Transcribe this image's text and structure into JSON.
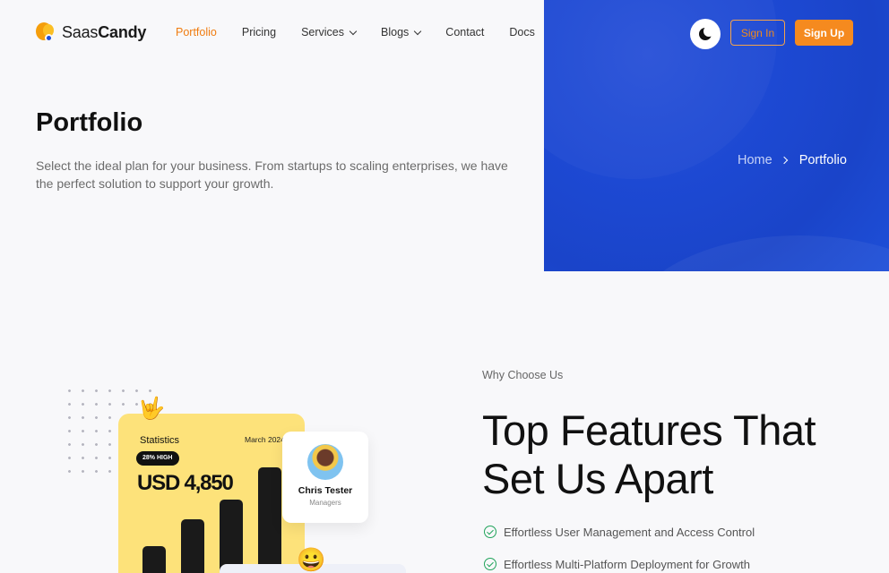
{
  "header": {
    "logo_text_light": "Saas",
    "logo_text_bold": "Candy",
    "nav": [
      {
        "label": "Portfolio",
        "active": true
      },
      {
        "label": "Pricing"
      },
      {
        "label": "Services",
        "dropdown": true
      },
      {
        "label": "Blogs",
        "dropdown": true
      },
      {
        "label": "Contact"
      },
      {
        "label": "Docs"
      }
    ],
    "signin_label": "Sign In",
    "signup_label": "Sign Up"
  },
  "hero": {
    "title": "Portfolio",
    "subtitle": "Select the ideal plan for your business. From startups to scaling enterprises, we have the perfect solution to support your growth.",
    "breadcrumb": {
      "home": "Home",
      "current": "Portfolio"
    }
  },
  "illustration": {
    "stats_title": "Statistics",
    "stats_date": "March 2024",
    "stats_pill": "28% HIGH",
    "stats_amount": "USD 4,850",
    "bars": [
      0.26,
      0.45,
      0.59,
      0.81
    ],
    "profile_name": "Chris Tester",
    "profile_role": "Managers",
    "hand_emoji": "🤟",
    "smile_emoji": "😀"
  },
  "features": {
    "eyebrow": "Why Choose Us",
    "headline": "Top Features That Set Us Apart",
    "items": [
      "Effortless User Management and Access Control",
      "Effortless Multi-Platform Deployment for Growth"
    ]
  },
  "colors": {
    "accent": "#f58a1f",
    "hero_blue": "#1d49d3",
    "check_green": "#20a35a",
    "card_yellow": "#fde27a"
  }
}
